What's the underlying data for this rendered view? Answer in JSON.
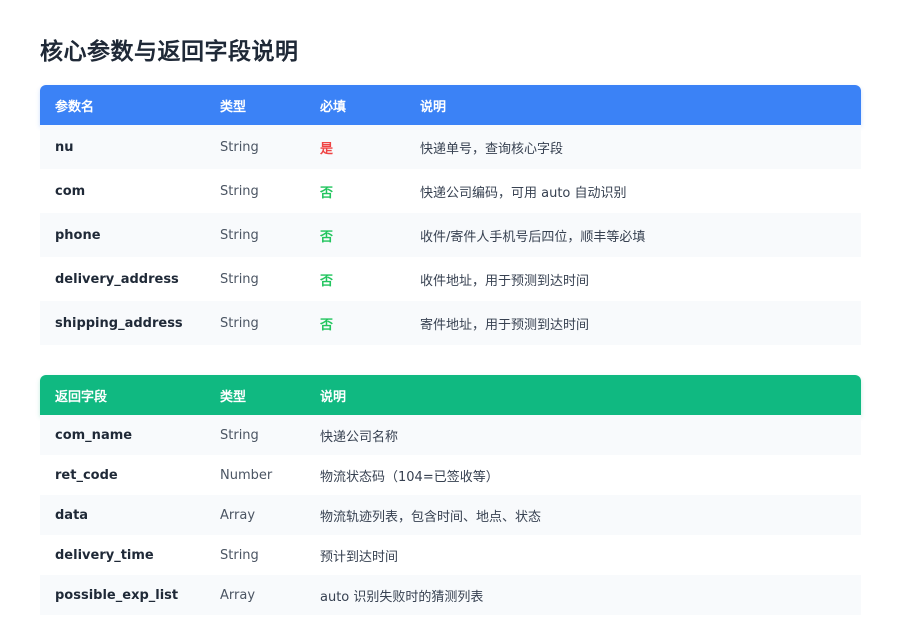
{
  "title": "核心参数与返回字段说明",
  "params": {
    "headers": [
      "参数名",
      "类型",
      "必填",
      "说明"
    ],
    "rows": [
      {
        "name": "nu",
        "type": "String",
        "required": "是",
        "desc": "快递单号，查询核心字段"
      },
      {
        "name": "com",
        "type": "String",
        "required": "否",
        "desc": "快递公司编码，可用 auto 自动识别"
      },
      {
        "name": "phone",
        "type": "String",
        "required": "否",
        "desc": "收件/寄件人手机号后四位，顺丰等必填"
      },
      {
        "name": "delivery_address",
        "type": "String",
        "required": "否",
        "desc": "收件地址，用于预测到达时间"
      },
      {
        "name": "shipping_address",
        "type": "String",
        "required": "否",
        "desc": "寄件地址，用于预测到达时间"
      }
    ]
  },
  "returns": {
    "headers": [
      "返回字段",
      "类型",
      "说明"
    ],
    "rows": [
      {
        "name": "com_name",
        "type": "String",
        "desc": "快递公司名称"
      },
      {
        "name": "ret_code",
        "type": "Number",
        "desc": "物流状态码（104=已签收等）"
      },
      {
        "name": "data",
        "type": "Array",
        "desc": "物流轨迹列表，包含时间、地点、状态"
      },
      {
        "name": "delivery_time",
        "type": "String",
        "desc": "预计到达时间"
      },
      {
        "name": "possible_exp_list",
        "type": "Array",
        "desc": "auto 识别失败时的猜测列表"
      }
    ]
  },
  "colors": {
    "params_header": "#3b82f6",
    "returns_header": "#10b981",
    "required_yes": "#ef4444",
    "required_no": "#22c55e"
  }
}
